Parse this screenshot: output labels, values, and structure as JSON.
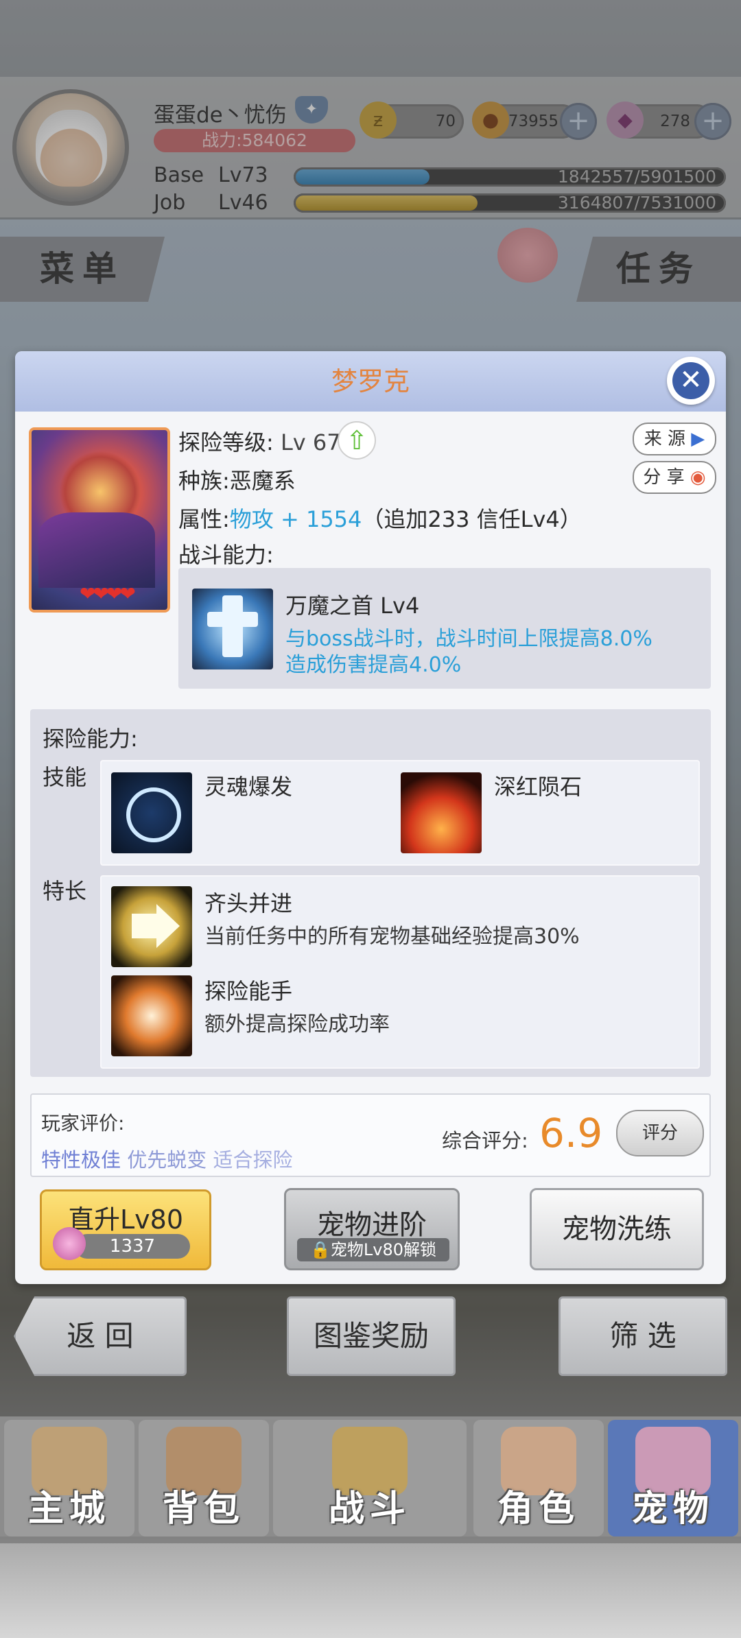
{
  "header": {
    "player_name": "蛋蛋de丶忧伤",
    "power_label": "战力:584062",
    "resources": [
      {
        "icon": "zeny-coin-icon",
        "value": "70"
      },
      {
        "icon": "gold-bag-icon",
        "value": "73955"
      },
      {
        "icon": "crystal-icon",
        "value": "278"
      }
    ],
    "base": {
      "label": "Base",
      "level": "Lv73",
      "progress": "1842557/5901500",
      "fill": 0.31
    },
    "job": {
      "label": "Job",
      "level": "Lv46",
      "progress": "3164807/7531000",
      "fill": 0.42
    },
    "menu_label": "菜单",
    "task_label": "任务"
  },
  "modal": {
    "title": "梦罗克",
    "adventure_level_label": "探险等级:",
    "adventure_level_value": "Lv 67",
    "race_label": "种族:",
    "race_value": "恶魔系",
    "attr_label": "属性:",
    "attr_value": "物攻 + 1554",
    "attr_extra": "（追加233 信任Lv4）",
    "battle_label": "战斗能力:",
    "source_chip": "来 源",
    "share_chip": "分 享",
    "battle_skill": {
      "name": "万魔之首 Lv4",
      "desc1": "与boss战斗时，战斗时间上限提高8.0%",
      "desc2": "造成伤害提高4.0%"
    },
    "explore_label": "探险能力:",
    "skills_label": "技能",
    "skills": [
      {
        "name": "灵魂爆发"
      },
      {
        "name": "深红陨石"
      }
    ],
    "traits_label": "特长",
    "traits": [
      {
        "name": "齐头并进",
        "desc": "当前任务中的所有宠物基础经验提高30%"
      },
      {
        "name": "探险能手",
        "desc": "额外提高探险成功率"
      }
    ],
    "rating": {
      "player_label": "玩家评价:",
      "tags": [
        "特性极佳",
        "优先蜕变",
        "适合探险"
      ],
      "score_label": "综合评分:",
      "score": "6.9",
      "rate_button": "评分"
    },
    "buttons": {
      "direct_up": "直升Lv80",
      "direct_cost": "1337",
      "advance": "宠物进阶",
      "advance_lock": "宠物Lv80解锁",
      "refine": "宠物洗练"
    }
  },
  "bottom": {
    "back": "返 回",
    "reward": "图鉴奖励",
    "filter": "筛 选"
  },
  "nav": [
    {
      "label": "主城"
    },
    {
      "label": "背包"
    },
    {
      "label": "战斗"
    },
    {
      "label": "角色"
    },
    {
      "label": "宠物"
    }
  ]
}
